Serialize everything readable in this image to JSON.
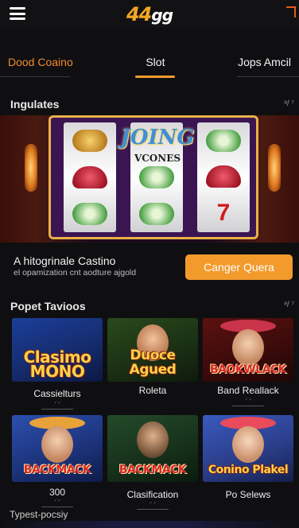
{
  "header": {
    "logo_main": "44",
    "logo_accent": "gg"
  },
  "tabs": [
    {
      "label": "Dood Coaino",
      "active": false
    },
    {
      "label": "Slot",
      "active": true
    },
    {
      "label": "Jops Amcil",
      "active": false
    }
  ],
  "featured": {
    "heading": "Ingulates",
    "more": "ᵊ/ ⁷",
    "machine_title": "JOING",
    "machine_sub": "VCONES",
    "promo_title": "A hitogrinale Castino",
    "promo_sub": "el opamization cnt aodture ajgold",
    "cta_label": "Canger Quera"
  },
  "popular": {
    "heading": "Popet Tavioos",
    "more": "ᵊ/ ⁷",
    "games": [
      {
        "art": "Clasimo MONO",
        "label": "Cassielturs",
        "mini": "ᐟ ᐟ"
      },
      {
        "art": "Duoce Agued",
        "label": "Roleta",
        "mini": ""
      },
      {
        "art": "BAOKWLACK",
        "label": "Band Reallack",
        "mini": "ᐟ ᐟ"
      },
      {
        "art": "BACKMACK",
        "label": "300",
        "mini": "ᐟ ᐟ"
      },
      {
        "art": "BACKMACK",
        "label": "Clasification",
        "mini": "ᐟ ᐟ"
      },
      {
        "art": "Conino Plakel",
        "label": "Po Selews",
        "mini": ""
      }
    ]
  },
  "footer_section": {
    "heading": "Typest-pocsiy"
  },
  "colors": {
    "accent": "#f39a2d",
    "background": "#0f0f12",
    "tab_orange": "#f08a2c"
  }
}
